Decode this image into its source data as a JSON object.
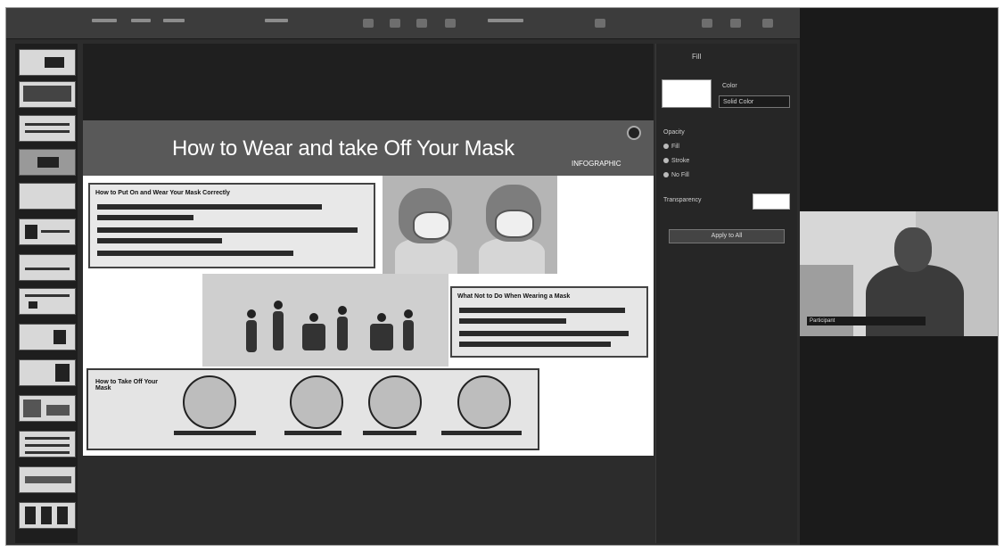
{
  "slide": {
    "title": "How to Wear and take Off Your Mask",
    "subtitle": "INFOGRAPHIC",
    "box1_heading": "How to Put On and Wear Your Mask Correctly",
    "box2_heading": "What Not to Do When Wearing a Mask",
    "box3_heading": "How to Take Off Your Mask"
  },
  "inspector": {
    "header": "Fill",
    "swatch_label": "Color",
    "select_value": "Solid Color",
    "section_label": "Opacity",
    "radio_1": "Fill",
    "radio_2": "Stroke",
    "radio_3": "No Fill",
    "transparency_label": "Transparency",
    "button_label": "Apply to All"
  },
  "video": {
    "participant_name": "Participant"
  },
  "colors": {
    "app_bg": "#2c2c2c",
    "slide_header": "#595959",
    "frame_border": "#9a9a9a"
  }
}
